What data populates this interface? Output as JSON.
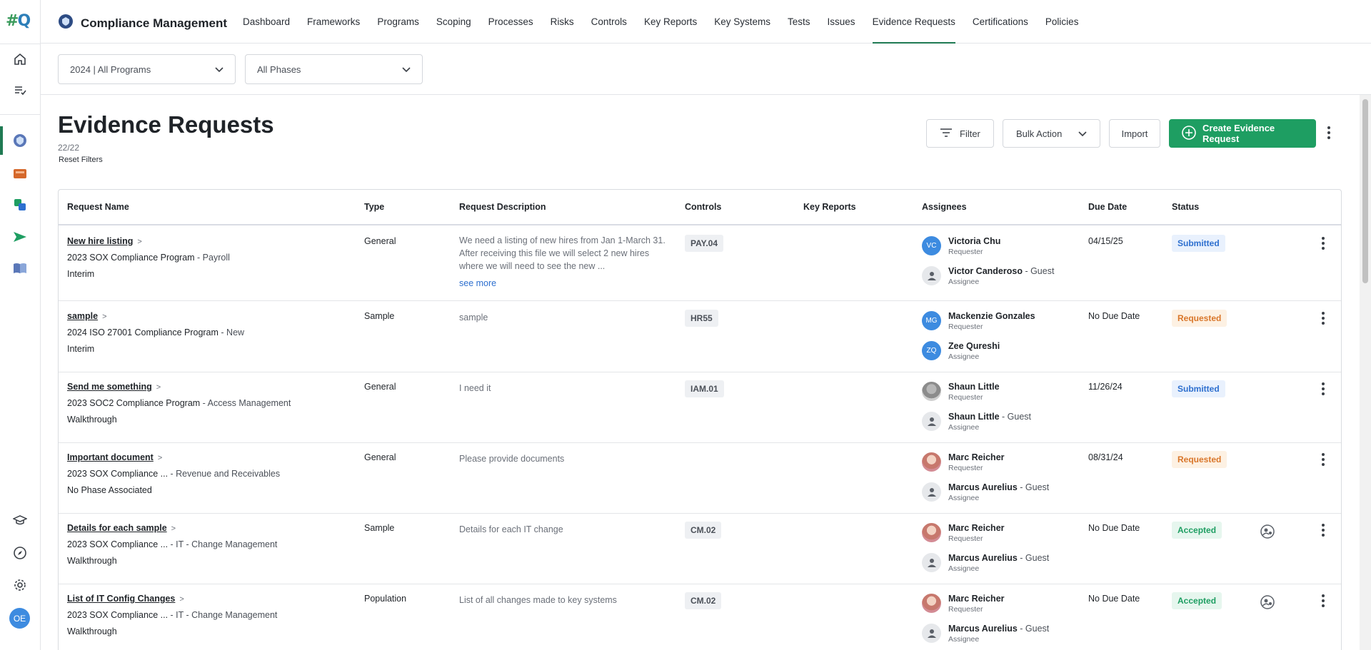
{
  "rail": {
    "logo_left": "#",
    "logo_right": "Q",
    "avatar_initials": "OE"
  },
  "app": {
    "title": "Compliance Management"
  },
  "nav": {
    "items": [
      "Dashboard",
      "Frameworks",
      "Programs",
      "Scoping",
      "Processes",
      "Risks",
      "Controls",
      "Key Reports",
      "Key Systems",
      "Tests",
      "Issues",
      "Evidence Requests",
      "Certifications",
      "Policies"
    ],
    "active": "Evidence Requests"
  },
  "filters": {
    "program": "2024 | All Programs",
    "phase": "All Phases"
  },
  "page": {
    "title": "Evidence Requests",
    "count": "22/22",
    "reset": "Reset Filters"
  },
  "toolbar": {
    "filter": "Filter",
    "bulk": "Bulk Action",
    "import": "Import",
    "create": "Create Evidence Request"
  },
  "table": {
    "headers": {
      "name": "Request Name",
      "type": "Type",
      "desc": "Request Description",
      "controls": "Controls",
      "key_reports": "Key Reports",
      "assignees": "Assignees",
      "due": "Due Date",
      "status": "Status"
    },
    "rows": [
      {
        "name": "New hire listing",
        "program": "2023 SOX Compliance Program",
        "sub": "Payroll",
        "phase": "Interim",
        "type": "General",
        "desc": "We need a listing of new hires from Jan 1-March 31. After receiving this file we will select 2 new hires where we will need to see the new ...",
        "see_more": "see more",
        "control": "PAY.04",
        "requester": {
          "name": "Victoria Chu",
          "role": "Requester",
          "initials": "VC"
        },
        "assignee": {
          "name": "Victor Canderoso",
          "guest": " - Guest",
          "role": "Assignee"
        },
        "due": "04/15/25",
        "status": "Submitted"
      },
      {
        "name": "sample",
        "program": "2024 ISO 27001 Compliance Program",
        "sub": "New",
        "phase": "Interim",
        "type": "Sample",
        "desc": "sample",
        "control": "HR55",
        "requester": {
          "name": "Mackenzie Gonzales",
          "role": "Requester",
          "initials": "MG"
        },
        "assignee": {
          "name": "Zee Qureshi",
          "role": "Assignee",
          "initials": "ZQ"
        },
        "due": "No Due Date",
        "status": "Requested"
      },
      {
        "name": "Send me something",
        "program": "2023 SOC2 Compliance Program",
        "sub": "Access Management",
        "phase": "Walkthrough",
        "type": "General",
        "desc": "I need it",
        "control": "IAM.01",
        "requester": {
          "name": "Shaun Little",
          "role": "Requester"
        },
        "assignee": {
          "name": "Shaun Little",
          "guest": " - Guest",
          "role": "Assignee"
        },
        "due": "11/26/24",
        "status": "Submitted"
      },
      {
        "name": "Important document",
        "program": "2023 SOX Compliance ...",
        "sub": "Revenue and Receivables",
        "phase": "No Phase Associated",
        "type": "General",
        "desc": "Please provide documents",
        "control": "",
        "requester": {
          "name": "Marc Reicher",
          "role": "Requester"
        },
        "assignee": {
          "name": "Marcus Aurelius",
          "guest": " - Guest",
          "role": "Assignee"
        },
        "due": "08/31/24",
        "status": "Requested"
      },
      {
        "name": "Details for each sample",
        "program": "2023 SOX Compliance ...",
        "sub": "IT - Change Management",
        "phase": "Walkthrough",
        "type": "Sample",
        "desc": "Details for each IT change",
        "control": "CM.02",
        "requester": {
          "name": "Marc Reicher",
          "role": "Requester"
        },
        "assignee": {
          "name": "Marcus Aurelius",
          "guest": " - Guest",
          "role": "Assignee"
        },
        "due": "No Due Date",
        "status": "Accepted"
      },
      {
        "name": "List of IT Config Changes",
        "program": "2023 SOX Compliance ...",
        "sub": "IT - Change Management",
        "phase": "Walkthrough",
        "type": "Population",
        "desc": "List of all changes made to key systems",
        "control": "CM.02",
        "requester": {
          "name": "Marc Reicher",
          "role": "Requester"
        },
        "assignee": {
          "name": "Marcus Aurelius",
          "guest": " - Guest",
          "role": "Assignee"
        },
        "due": "No Due Date",
        "status": "Accepted"
      }
    ]
  }
}
